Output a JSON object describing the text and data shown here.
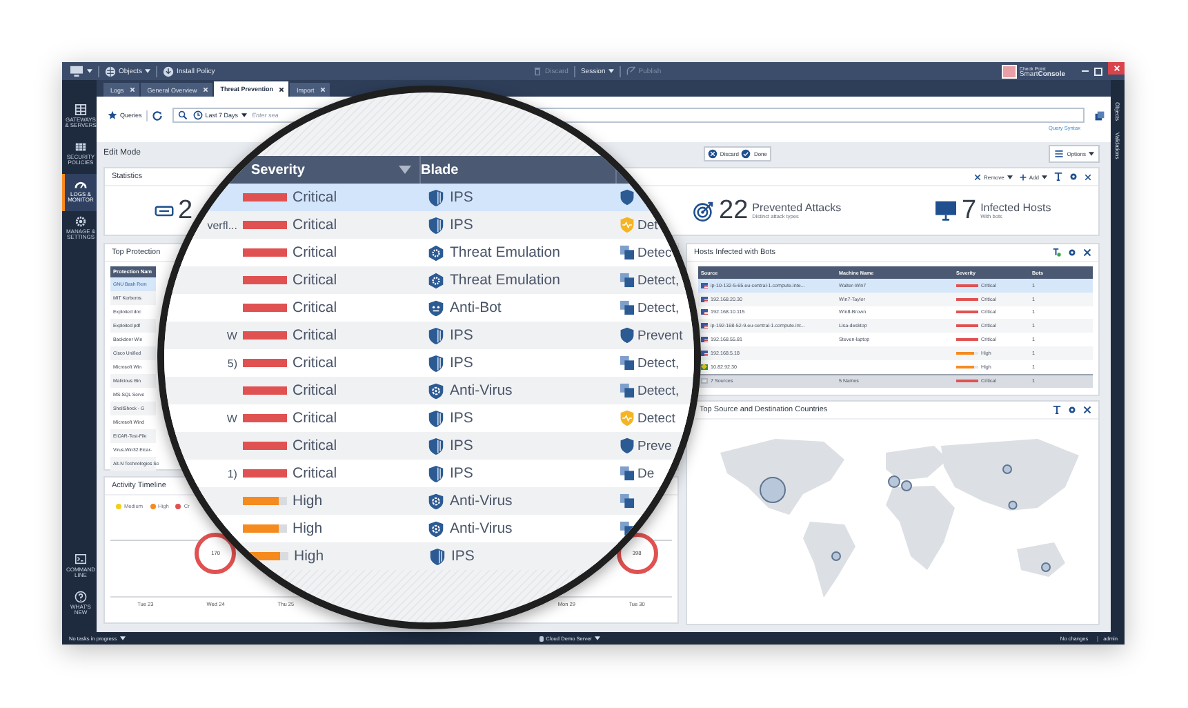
{
  "title_bar": {
    "menu_items": [
      {
        "label": "Objects",
        "kind": "globe",
        "dropdown": true
      },
      {
        "label": "Install Policy",
        "kind": "install",
        "dropdown": false
      }
    ],
    "session_items": [
      {
        "label": "Discard",
        "kind": "trash",
        "dropdown": false,
        "disabled": true
      },
      {
        "label": "Session",
        "kind": "plain",
        "dropdown": true,
        "disabled": false
      },
      {
        "label": "Publish",
        "kind": "publish",
        "dropdown": false,
        "disabled": true
      }
    ],
    "brand": {
      "company": "Check Point",
      "product": "Smart**Console**"
    }
  },
  "nav": {
    "items": [
      {
        "label": "GATEWAYS & SERVERS",
        "kind": "gateways",
        "selected": false
      },
      {
        "label": "SECURITY POLICIES",
        "kind": "policies",
        "selected": false
      },
      {
        "label": "LOGS & MONITOR",
        "kind": "logs",
        "selected": true
      },
      {
        "label": "MANAGE & SETTINGS",
        "kind": "gear",
        "selected": false
      }
    ],
    "bottom_items": [
      {
        "label": "COMMAND LINE",
        "kind": "command"
      },
      {
        "label": "WHAT'S NEW",
        "kind": "help"
      }
    ]
  },
  "tabs": [
    {
      "label": "Logs",
      "selected": false
    },
    {
      "label": "General Overview",
      "selected": false
    },
    {
      "label": "Threat Prevention",
      "selected": true
    },
    {
      "label": "Import",
      "selected": false
    }
  ],
  "right_strip": [
    "Objects",
    "Validations"
  ],
  "query_bar": {
    "queries": "Queries",
    "time_range": "Last 7 Days",
    "placeholder": "Enter sea",
    "syntax_link": "Query Syntax"
  },
  "edit_bar": {
    "title": "Edit Mode",
    "buttons": [
      {
        "label": "Discard",
        "kind": "discard"
      },
      {
        "label": "Done",
        "kind": "done"
      }
    ],
    "options": "Options"
  },
  "statistics": {
    "title": "Statistics",
    "toolbar": [
      {
        "label": "Remove",
        "kind": "remove"
      },
      {
        "label": "Add",
        "kind": "add"
      }
    ],
    "stats": [
      {
        "kind": "server",
        "value": "2"
      },
      {
        "kind": "target",
        "value": "22",
        "label": "Prevented Attacks",
        "sub": "Distinct attack types"
      },
      {
        "kind": "monitor",
        "value": "7",
        "label": "Infected Hosts",
        "sub": "With bots"
      }
    ]
  },
  "top_protections": {
    "title": "Top Protection",
    "column": "Protection Nam",
    "rows": [
      {
        "name": "GNU Bash Rem",
        "selected": true
      },
      {
        "name": "MIT Kerberos",
        "selected": false
      },
      {
        "name": "Exploited doc",
        "selected": false
      },
      {
        "name": "Exploited pdf",
        "selected": false
      },
      {
        "name": "Backdoor Win",
        "selected": false
      },
      {
        "name": "Cisco Unified",
        "selected": false
      },
      {
        "name": "Microsoft Win",
        "selected": false
      },
      {
        "name": "Malicious Bin",
        "selected": false
      },
      {
        "name": "MS-SQL Serve",
        "selected": false
      },
      {
        "name": "ShellShock - G",
        "selected": false
      },
      {
        "name": "Microsoft Wind",
        "selected": false
      },
      {
        "name": "EICAR-Test-File",
        "selected": false
      },
      {
        "name": "Virus.Win32.Eicar-",
        "selected": false
      },
      {
        "name": "Alt-N Technologies Se",
        "selected": false
      }
    ]
  },
  "activity_timeline": {
    "title": "Activity Timeline",
    "legend": [
      {
        "label": "Medium",
        "color": "#f3cf14"
      },
      {
        "label": "High",
        "color": "#f58a1f"
      },
      {
        "label": "Cr",
        "color": "#e15151"
      }
    ],
    "markers": [
      {
        "value": "170"
      },
      {
        "value": "398"
      }
    ],
    "axis_left": [
      "Tue 23",
      "Wed 24",
      "Thu 25"
    ],
    "axis_right": [
      "Mon 29",
      "Tue 30"
    ]
  },
  "hosts": {
    "title": "Hosts Infected with Bots",
    "columns": [
      "Source",
      "Machine Name",
      "Severity",
      "Bots"
    ],
    "rows": [
      {
        "kind": "us",
        "source": "ip-10-132-5-65.eu-central-1.compute.inte...",
        "machine": "Walter-Win7",
        "severity": "Critical",
        "level": 1,
        "color": "#e05252",
        "bots": "1",
        "selected": true
      },
      {
        "kind": "us",
        "source": "192.168.20.30",
        "machine": "Win7-Taylor",
        "severity": "Critical",
        "level": 1,
        "color": "#e05252",
        "bots": "1",
        "selected": false
      },
      {
        "kind": "us",
        "source": "192.168.10.115",
        "machine": "Win8-Brown",
        "severity": "Critical",
        "level": 1,
        "color": "#e05252",
        "bots": "1",
        "selected": false
      },
      {
        "kind": "us",
        "source": "ip-192-168-52-9.eu-central-1.compute.int...",
        "machine": "Lisa-desktop",
        "severity": "Critical",
        "level": 1,
        "color": "#e05252",
        "bots": "1",
        "selected": false
      },
      {
        "kind": "us",
        "source": "192.168.55.81",
        "machine": "Steven-laptop",
        "severity": "Critical",
        "level": 1,
        "color": "#e05252",
        "bots": "1",
        "selected": false
      },
      {
        "kind": "us",
        "source": "192.168.5.18",
        "severity": "High",
        "level": 0.8,
        "color": "#f58a1f",
        "bots": "1",
        "selected": false
      },
      {
        "kind": "br",
        "source": "10.82.92.30",
        "severity": "High",
        "level": 0.8,
        "color": "#f58a1f",
        "bots": "1",
        "selected": false
      }
    ],
    "total": {
      "source": "7 Sources",
      "machine": "5 Names",
      "severity": "Critical",
      "level": 1,
      "color": "#e05252",
      "bots": "1"
    }
  },
  "countries": {
    "title": "Top Source and Destination Countries"
  },
  "magnifier": {
    "columns": [
      {
        "label": "Severity",
        "sortable": true
      },
      {
        "label": "Blade",
        "sortable": false
      }
    ],
    "rows": [
      {
        "severity": "Critical",
        "level": 1,
        "color": "#e05252",
        "blade": {
          "label": "IPS",
          "kind": "ips"
        },
        "action": {
          "kind": "shield"
        },
        "selected": true
      },
      {
        "fragment": "verfl...",
        "severity": "Critical",
        "level": 1,
        "color": "#e05252",
        "blade": {
          "label": "IPS",
          "kind": "ips"
        },
        "action": {
          "kind": "shield-alert",
          "label": "Det"
        },
        "selected": false
      },
      {
        "severity": "Critical",
        "level": 1,
        "color": "#e05252",
        "blade": {
          "label": "Threat Emulation",
          "kind": "emulation"
        },
        "action": {
          "kind": "copies",
          "label": "Detec"
        },
        "selected": false
      },
      {
        "severity": "Critical",
        "level": 1,
        "color": "#e05252",
        "blade": {
          "label": "Threat Emulation",
          "kind": "emulation"
        },
        "action": {
          "kind": "copies",
          "label": "Detect,"
        },
        "selected": false
      },
      {
        "severity": "Critical",
        "level": 1,
        "color": "#e05252",
        "blade": {
          "label": "Anti-Bot",
          "kind": "antibot"
        },
        "action": {
          "kind": "copies",
          "label": "Detect,"
        },
        "selected": false
      },
      {
        "fragment": "W",
        "severity": "Critical",
        "level": 1,
        "color": "#e05252",
        "blade": {
          "label": "IPS",
          "kind": "ips"
        },
        "action": {
          "kind": "shield",
          "label": "Prevent"
        },
        "selected": false
      },
      {
        "fragment": "5)",
        "severity": "Critical",
        "level": 1,
        "color": "#e05252",
        "blade": {
          "label": "IPS",
          "kind": "ips"
        },
        "action": {
          "kind": "copies",
          "label": "Detect,"
        },
        "selected": false
      },
      {
        "severity": "Critical",
        "level": 1,
        "color": "#e05252",
        "blade": {
          "label": "Anti-Virus",
          "kind": "antivirus"
        },
        "action": {
          "kind": "copies",
          "label": "Detect,"
        },
        "selected": false
      },
      {
        "fragment": "W",
        "severity": "Critical",
        "level": 1,
        "color": "#e05252",
        "blade": {
          "label": "IPS",
          "kind": "ips"
        },
        "action": {
          "kind": "shield-alert",
          "label": "Detect"
        },
        "selected": false
      },
      {
        "severity": "Critical",
        "level": 1,
        "color": "#e05252",
        "blade": {
          "label": "IPS",
          "kind": "ips"
        },
        "action": {
          "kind": "shield",
          "label": "Preve"
        },
        "selected": false
      },
      {
        "fragment": "1)",
        "severity": "Critical",
        "level": 1,
        "color": "#e05252",
        "blade": {
          "label": "IPS",
          "kind": "ips"
        },
        "action": {
          "kind": "copies",
          "label": "De"
        },
        "selected": false
      },
      {
        "severity": "High",
        "level": 0.8,
        "color": "#f58a1f",
        "blade": {
          "label": "Anti-Virus",
          "kind": "antivirus"
        },
        "action": {
          "kind": "copies"
        },
        "selected": false
      },
      {
        "severity": "High",
        "level": 0.8,
        "color": "#f58a1f",
        "blade": {
          "label": "Anti-Virus",
          "kind": "antivirus"
        },
        "action": {
          "kind": "copies"
        },
        "selected": false
      },
      {
        "severity": "High",
        "level": 0.8,
        "color": "#f58a1f",
        "blade": {
          "label": "IPS",
          "kind": "ips"
        },
        "selected": false
      }
    ]
  },
  "status_bar": {
    "tasks": "No tasks in progress",
    "server": "Cloud Demo Server",
    "changes": "No changes",
    "user": "admin"
  }
}
